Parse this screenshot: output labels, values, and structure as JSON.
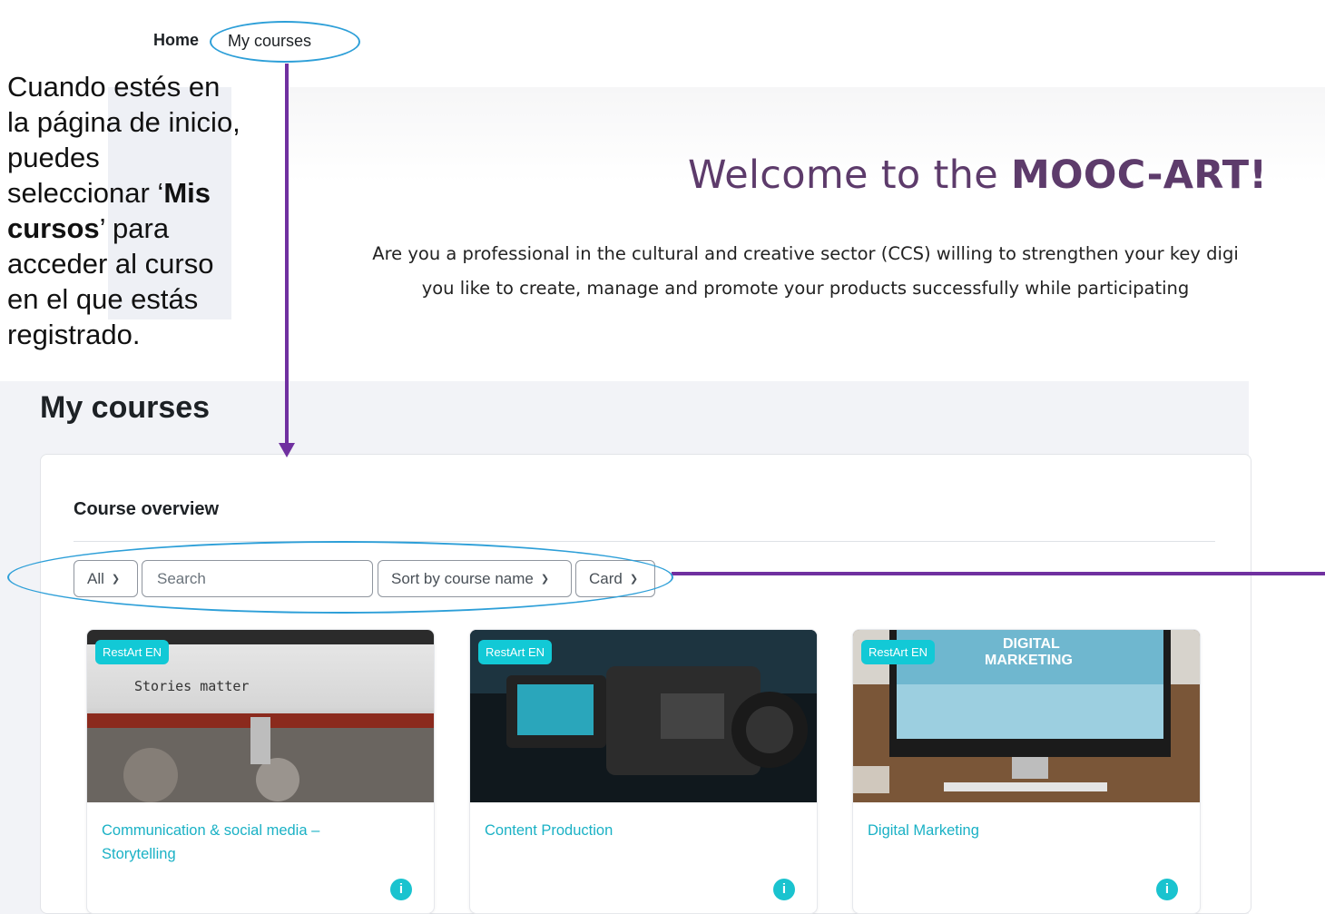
{
  "nav": {
    "home": "Home",
    "my_courses": "My courses"
  },
  "annotation": {
    "text_before": "Cuando estés en la página de inicio, puedes seleccionar ‘",
    "bold1": "Mis cursos",
    "text_after": "’ para acceder al curso en el que estás registrado."
  },
  "banner": {
    "welcome_prefix": "Welcome to the ",
    "welcome_brand": "MOOC-ART!",
    "intro_line1": "Are you a professional in the cultural and creative sector (CCS) willing to strengthen your key digi",
    "intro_line2": "you like to create, manage and promote your products successfully while participating"
  },
  "main": {
    "title": "My courses",
    "overview_title": "Course overview",
    "filters": {
      "grouping": "All",
      "search_placeholder": "Search",
      "sort": "Sort by course name",
      "view": "Card"
    },
    "courses": [
      {
        "badge": "RestArt EN",
        "name": "Communication & social media – Storytelling",
        "image_text": "Stories matter"
      },
      {
        "badge": "RestArt EN",
        "name": "Content Production"
      },
      {
        "badge": "RestArt EN",
        "name": "Digital Marketing",
        "image_text_1": "DIGITAL",
        "image_text_2": "MARKETING"
      }
    ]
  },
  "colors": {
    "accent_teal": "#12c9d6",
    "arrow_purple": "#7030a0",
    "ellipse_blue": "#2d9fd8",
    "welcome_purple": "#5d3b6b"
  }
}
